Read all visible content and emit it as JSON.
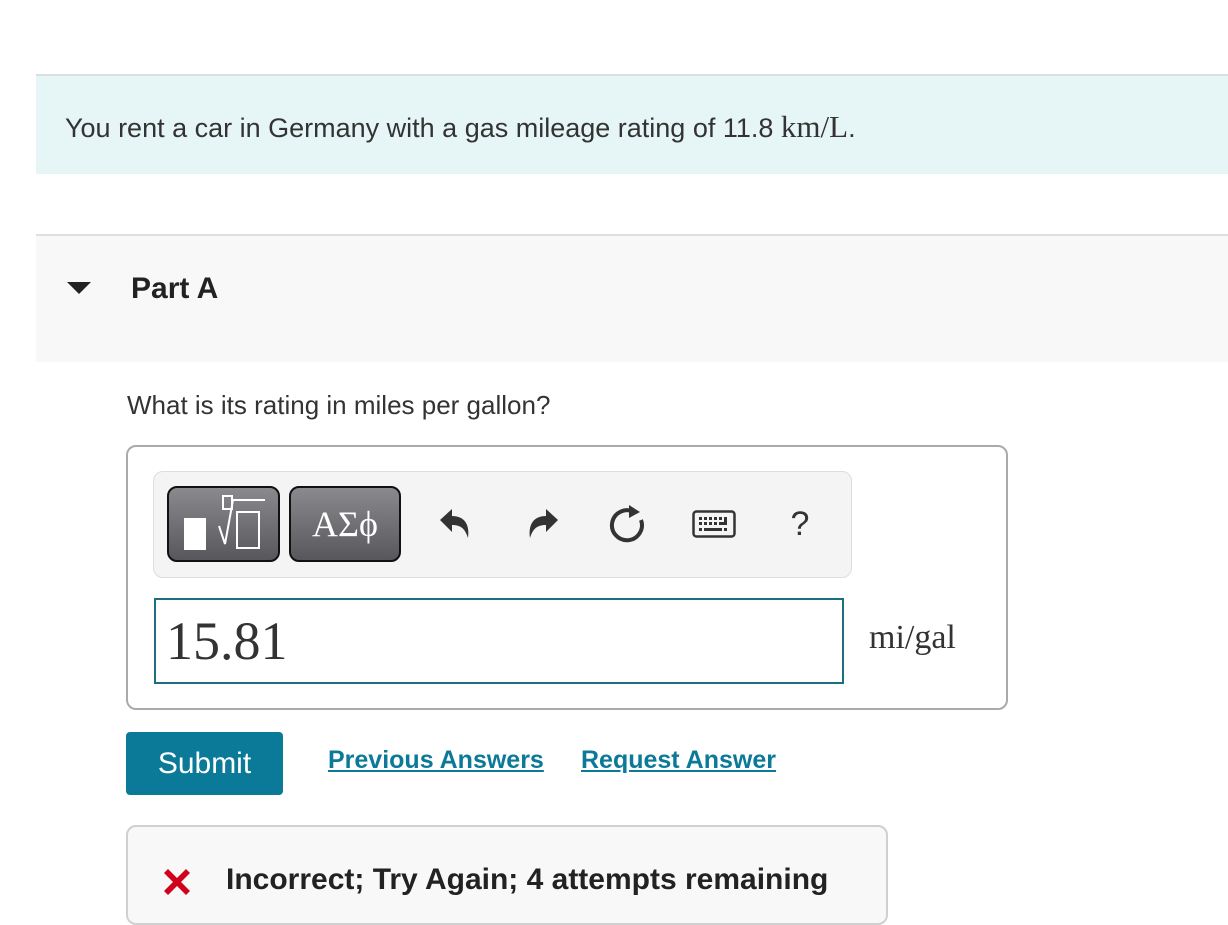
{
  "intro": {
    "text": "You rent a car in Germany with a gas mileage rating of 11.8 ",
    "unit": "km/L",
    "suffix": "."
  },
  "part": {
    "title": "Part A",
    "expanded": true,
    "question": "What is its rating in miles per gallon?"
  },
  "toolbar": {
    "template_button": "templates-icon",
    "greek_label": "ΑΣϕ",
    "undo": "undo-icon",
    "redo": "redo-icon",
    "reset": "reset-icon",
    "keyboard": "keyboard-icon",
    "help_label": "?"
  },
  "answer": {
    "value": "15.81",
    "unit": "mi/gal"
  },
  "actions": {
    "submit_label": "Submit",
    "previous_answers_label": "Previous Answers",
    "request_answer_label": "Request Answer"
  },
  "feedback": {
    "status": "incorrect",
    "message": "Incorrect; Try Again; 4 attempts remaining",
    "icon_color": "#d0021b"
  },
  "colors": {
    "accent": "#0b7a98",
    "intro_bg": "#e6f5f6",
    "input_border": "#1a7080"
  }
}
